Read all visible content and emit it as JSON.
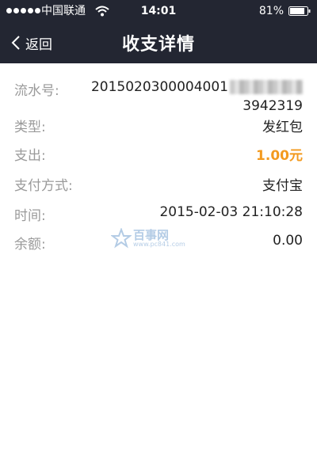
{
  "status_bar": {
    "carrier": "中国联通",
    "time": "14:01",
    "battery": "81%"
  },
  "nav": {
    "back_label": "返回",
    "title": "收支详情"
  },
  "details": {
    "serial": {
      "label": "流水号:",
      "value_line1": "2015020300004001",
      "value_line2": "3942319"
    },
    "type": {
      "label": "类型:",
      "value": "发红包"
    },
    "expense": {
      "label": "支出:",
      "value": "1.00元"
    },
    "payment_method": {
      "label": "支付方式:",
      "value": "支付宝"
    },
    "time": {
      "label": "时间:",
      "value": "2015-02-03 21:10:28"
    },
    "balance": {
      "label": "余额:",
      "value": "0.00"
    }
  },
  "watermark": {
    "text": "百事网",
    "sub": "www.pc841.com"
  },
  "colors": {
    "header_bg": "#232632",
    "label": "#9a9a9a",
    "amount": "#f39a1f"
  }
}
